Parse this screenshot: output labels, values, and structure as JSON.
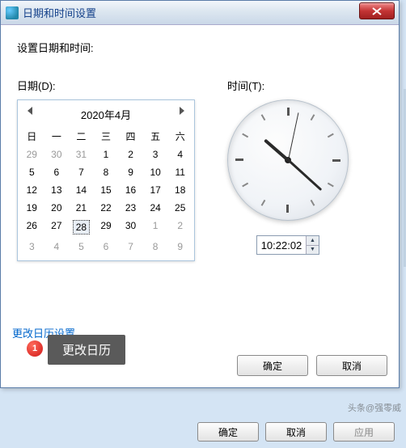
{
  "window": {
    "title": "日期和时间设置",
    "instruction": "设置日期和时间:"
  },
  "date": {
    "label": "日期(D):",
    "month_title": "2020年4月",
    "daynames": [
      "日",
      "一",
      "二",
      "三",
      "四",
      "五",
      "六"
    ],
    "rows": [
      [
        {
          "n": 29,
          "o": 1
        },
        {
          "n": 30,
          "o": 1
        },
        {
          "n": 31,
          "o": 1
        },
        {
          "n": 1
        },
        {
          "n": 2
        },
        {
          "n": 3
        },
        {
          "n": 4
        }
      ],
      [
        {
          "n": 5
        },
        {
          "n": 6
        },
        {
          "n": 7
        },
        {
          "n": 8
        },
        {
          "n": 9
        },
        {
          "n": 10
        },
        {
          "n": 11
        }
      ],
      [
        {
          "n": 12
        },
        {
          "n": 13
        },
        {
          "n": 14
        },
        {
          "n": 15
        },
        {
          "n": 16
        },
        {
          "n": 17
        },
        {
          "n": 18
        }
      ],
      [
        {
          "n": 19
        },
        {
          "n": 20
        },
        {
          "n": 21
        },
        {
          "n": 22
        },
        {
          "n": 23
        },
        {
          "n": 24
        },
        {
          "n": 25
        }
      ],
      [
        {
          "n": 26
        },
        {
          "n": 27
        },
        {
          "n": 28,
          "s": 1
        },
        {
          "n": 29
        },
        {
          "n": 30
        },
        {
          "n": 1,
          "o": 1
        },
        {
          "n": 2,
          "o": 1
        }
      ],
      [
        {
          "n": 3,
          "o": 1
        },
        {
          "n": 4,
          "o": 1
        },
        {
          "n": 5,
          "o": 1
        },
        {
          "n": 6,
          "o": 1
        },
        {
          "n": 7,
          "o": 1
        },
        {
          "n": 8,
          "o": 1
        },
        {
          "n": 9,
          "o": 1
        }
      ]
    ]
  },
  "time": {
    "label": "时间(T):",
    "value": "10:22:02",
    "hour": 10,
    "minute": 22,
    "second": 2
  },
  "link": {
    "text": "更改日历设置",
    "badge": "1",
    "tooltip": "更改日历"
  },
  "buttons": {
    "ok": "确定",
    "cancel": "取消",
    "apply": "应用"
  },
  "watermark": "头条@强零威"
}
